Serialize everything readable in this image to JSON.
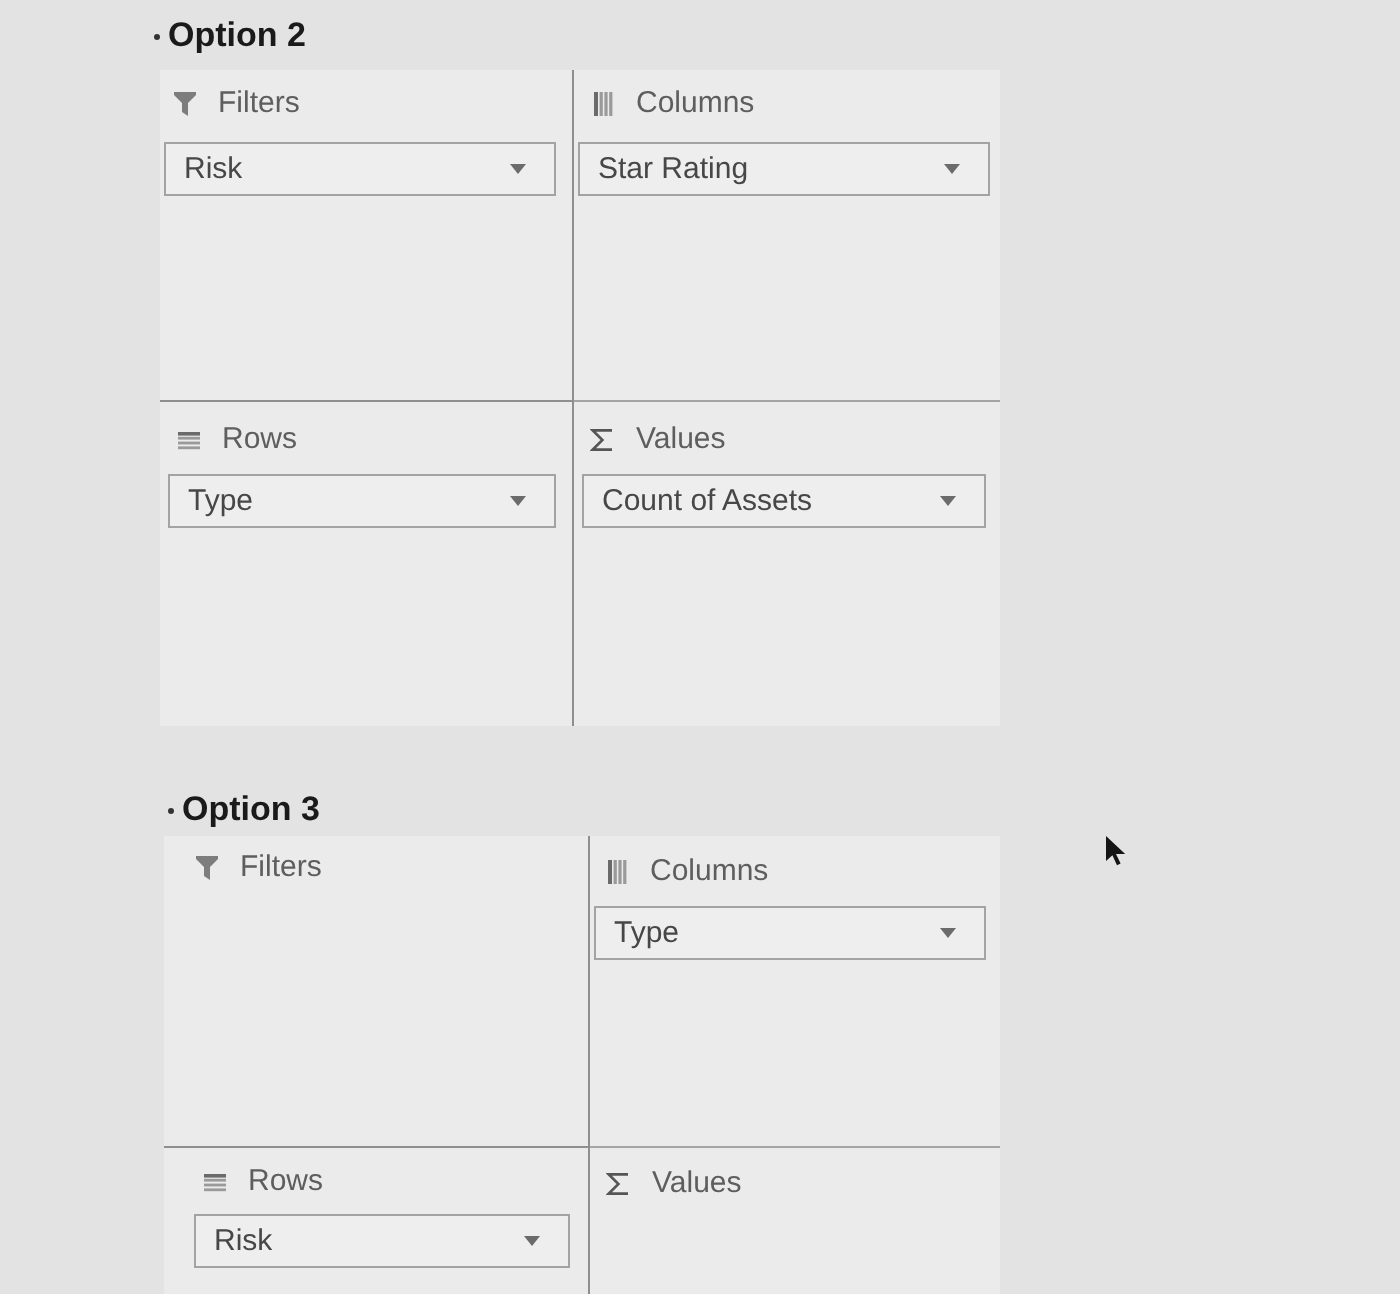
{
  "options": [
    {
      "title": "Option 2",
      "areas": [
        {
          "kind": "filters",
          "label": "Filters",
          "fields": [
            "Risk"
          ]
        },
        {
          "kind": "columns",
          "label": "Columns",
          "fields": [
            "Star Rating"
          ]
        },
        {
          "kind": "rows",
          "label": "Rows",
          "fields": [
            "Type"
          ]
        },
        {
          "kind": "values",
          "label": "Values",
          "fields": [
            "Count of Assets"
          ]
        }
      ]
    },
    {
      "title": "Option 3",
      "areas": [
        {
          "kind": "filters",
          "label": "Filters"
        },
        {
          "kind": "columns",
          "label": "Columns",
          "fields": [
            "Type"
          ]
        },
        {
          "kind": "rows",
          "label": "Rows",
          "fields": [
            "Risk"
          ]
        },
        {
          "kind": "values",
          "label": "Values"
        }
      ]
    }
  ]
}
